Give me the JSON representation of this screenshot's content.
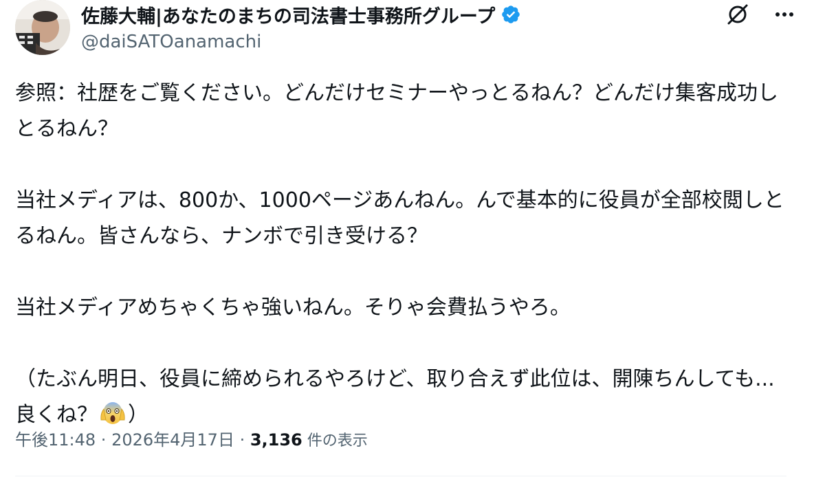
{
  "author": {
    "display_name": "佐藤大輔|あなたのまちの司法書士事務所グループ",
    "handle": "@daiSATOanamachi",
    "verified_color": "#1d9bf0",
    "avatar_icon": "user-avatar"
  },
  "actions": {
    "grok_icon": "grok-icon",
    "more_icon": "more-icon"
  },
  "tweet": {
    "p1": "参照：社歴をご覧ください。どんだけセミナーやっとるねん？どんだけ集客成功しとるねん？",
    "p2": "当社メディアは、800か、1000ページあんねん。んで基本的に役員が全部校閲しとるねん。皆さんなら、ナンボで引き受ける？",
    "p3": "当社メディアめちゃくちゃ強いねん。そりゃ会費払うやろ。",
    "p4_before_emoji": "（たぶん明日、役員に締められるやろけど、取り合えず此位は、開陳ちんしても...良くね？",
    "p4_emoji": "face-screaming-in-fear",
    "p4_after_emoji": "）"
  },
  "meta": {
    "time": "午後11:48",
    "separator": " · ",
    "date": "2026年4月17日",
    "views_count": "3,136",
    "views_label": " 件の表示"
  }
}
